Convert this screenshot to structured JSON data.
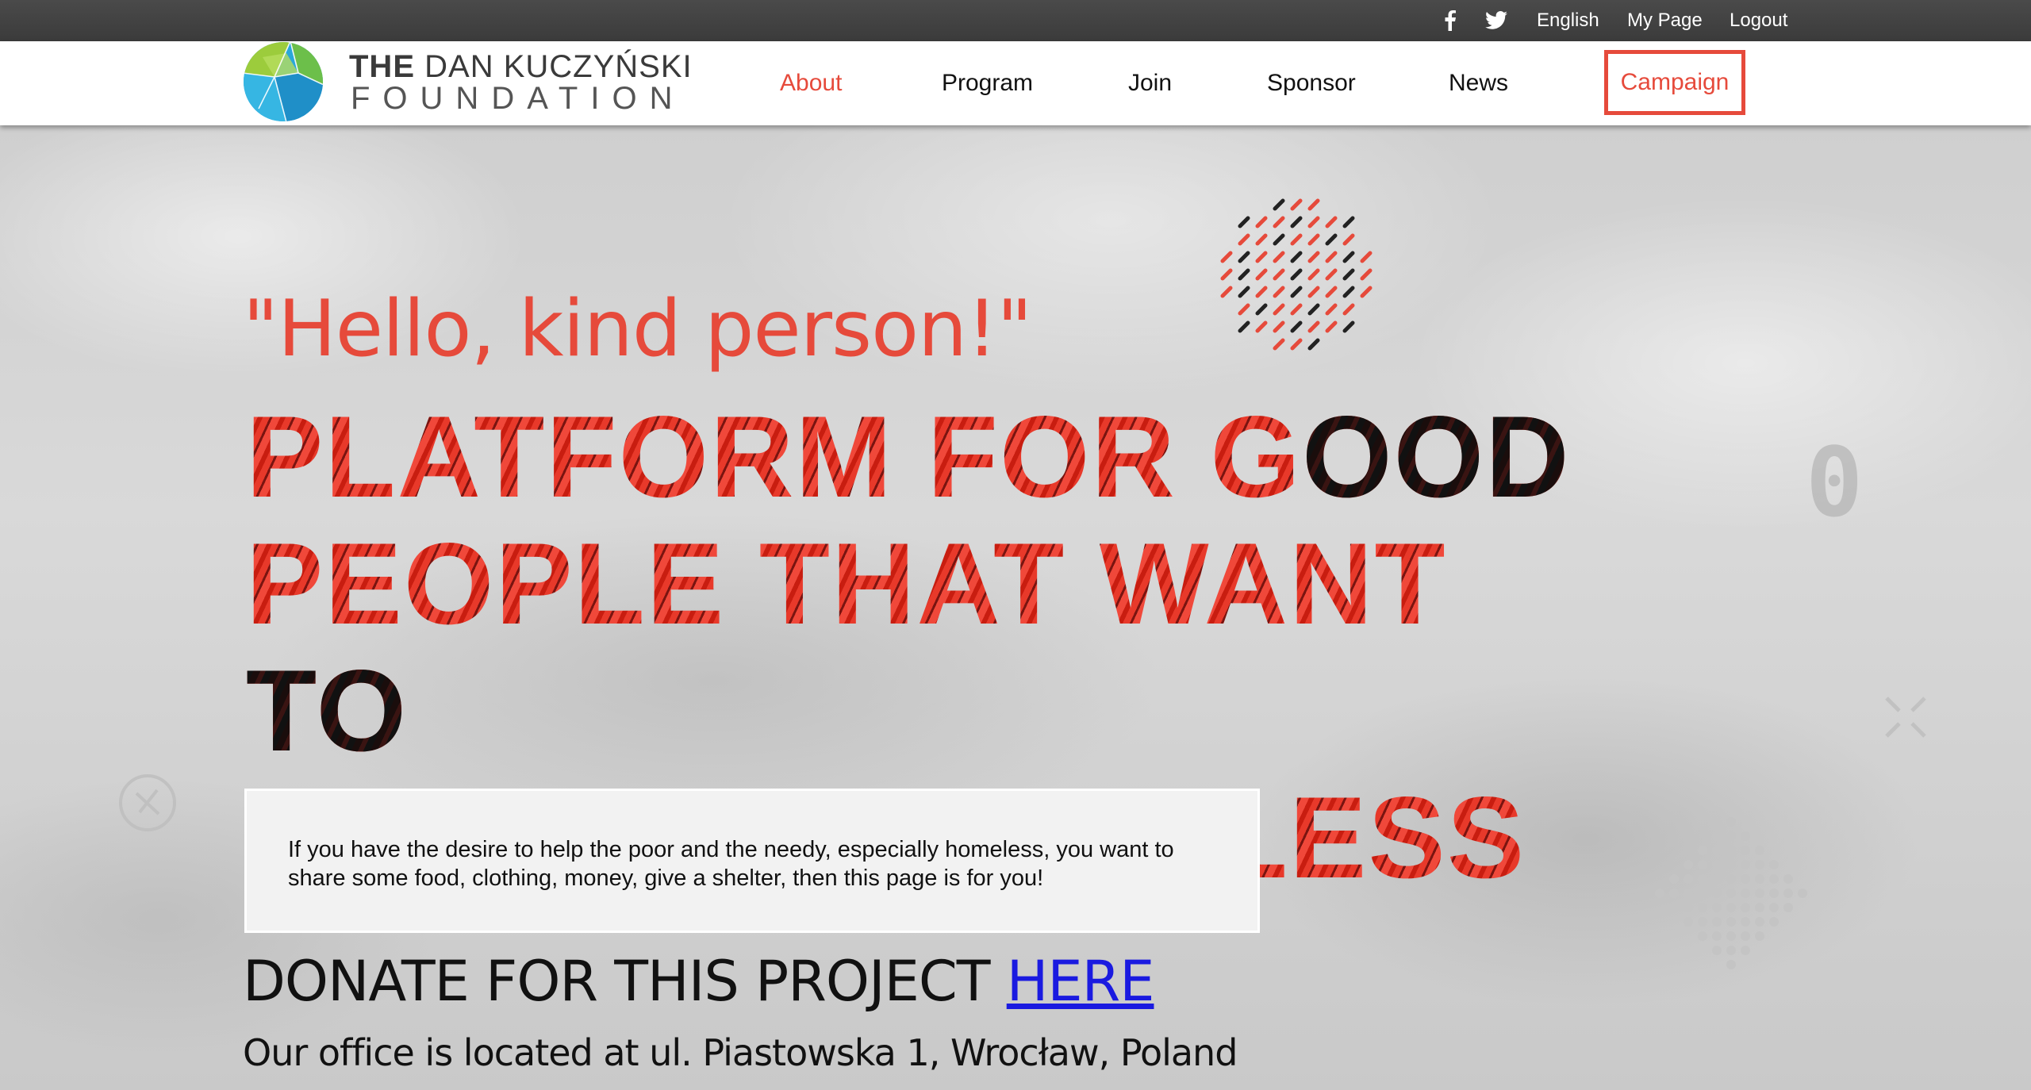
{
  "topbar": {
    "social": [
      {
        "icon": "facebook-icon"
      },
      {
        "icon": "twitter-icon"
      }
    ],
    "language": "English",
    "my_page": "My Page",
    "logout": "Logout"
  },
  "brand": {
    "line1_bold": "THE",
    "line1_rest": "DAN KUCZYŃSKI",
    "line2": "FOUNDATION",
    "icon": "globe-logo-icon"
  },
  "nav": {
    "items": [
      {
        "label": "About",
        "active": true
      },
      {
        "label": "Program"
      },
      {
        "label": "Join"
      },
      {
        "label": "Sponsor"
      },
      {
        "label": "News"
      }
    ],
    "campaign": "Campaign"
  },
  "hero": {
    "tagline": "\"Hello, kind person!\"",
    "headline": {
      "line1_red": "PLATFORM FOR G",
      "line1_dark": "OOD",
      "line2_red": "PEOPLE THAT WANT ",
      "line2_dark": "TO",
      "line3_red": "HELP THE HOMELESS"
    },
    "info_text": "If you have the desire to help the poor and the needy, especially homeless, you want to share some food, clothing, money, give a shelter, then this page is for you!",
    "donate_text": "DONATE FOR THIS PROJECT ",
    "donate_link": "HERE",
    "office": "Our office is located at ul. Piastowska 1, Wrocław, Poland"
  },
  "colors": {
    "accent": "#e64a3b",
    "topbar": "#3f3f3f",
    "link": "#1a1ae0"
  }
}
